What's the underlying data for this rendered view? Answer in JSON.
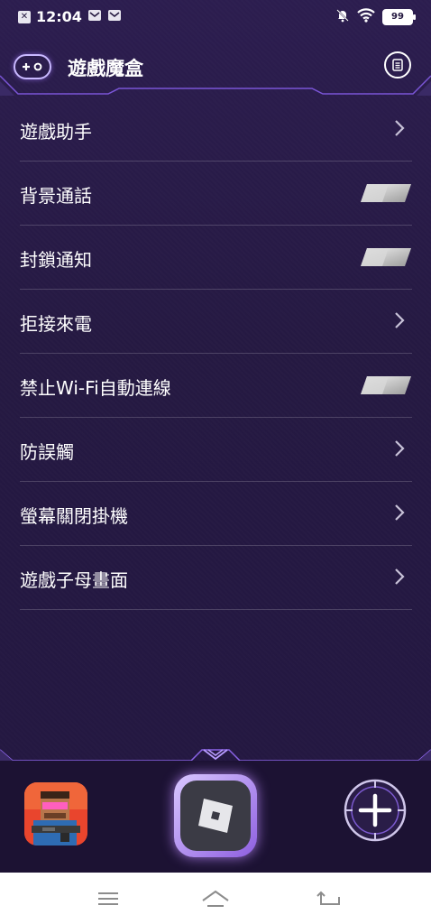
{
  "status_bar": {
    "time": "12:04",
    "battery": "99",
    "icons": [
      "screenshot-icon",
      "mail-icon",
      "mail-icon",
      "bell-off-icon",
      "wifi-icon",
      "battery-icon"
    ]
  },
  "header": {
    "title": "遊戲魔盒",
    "left_icon": "gamepad-icon",
    "right_icon": "notes-icon"
  },
  "settings": [
    {
      "label": "遊戲助手",
      "control": "chevron"
    },
    {
      "label": "背景通話",
      "control": "toggle",
      "state": "off"
    },
    {
      "label": "封鎖通知",
      "control": "toggle",
      "state": "off"
    },
    {
      "label": "拒接來電",
      "control": "chevron"
    },
    {
      "label": "禁止Wi-Fi自動連線",
      "control": "toggle",
      "state": "off"
    },
    {
      "label": "防誤觸",
      "control": "chevron"
    },
    {
      "label": "螢幕關閉掛機",
      "control": "chevron"
    },
    {
      "label": "遊戲子母畫面",
      "control": "chevron"
    }
  ],
  "dock": {
    "apps": [
      "pixel-gun-game-icon",
      "roblox-icon"
    ],
    "add_icon": "add-icon"
  },
  "navigation": {
    "icons": [
      "menu-icon",
      "home-icon",
      "back-icon"
    ]
  },
  "colors": {
    "background": "#24183f",
    "accent": "#a07cff",
    "text": "#ffffff"
  }
}
